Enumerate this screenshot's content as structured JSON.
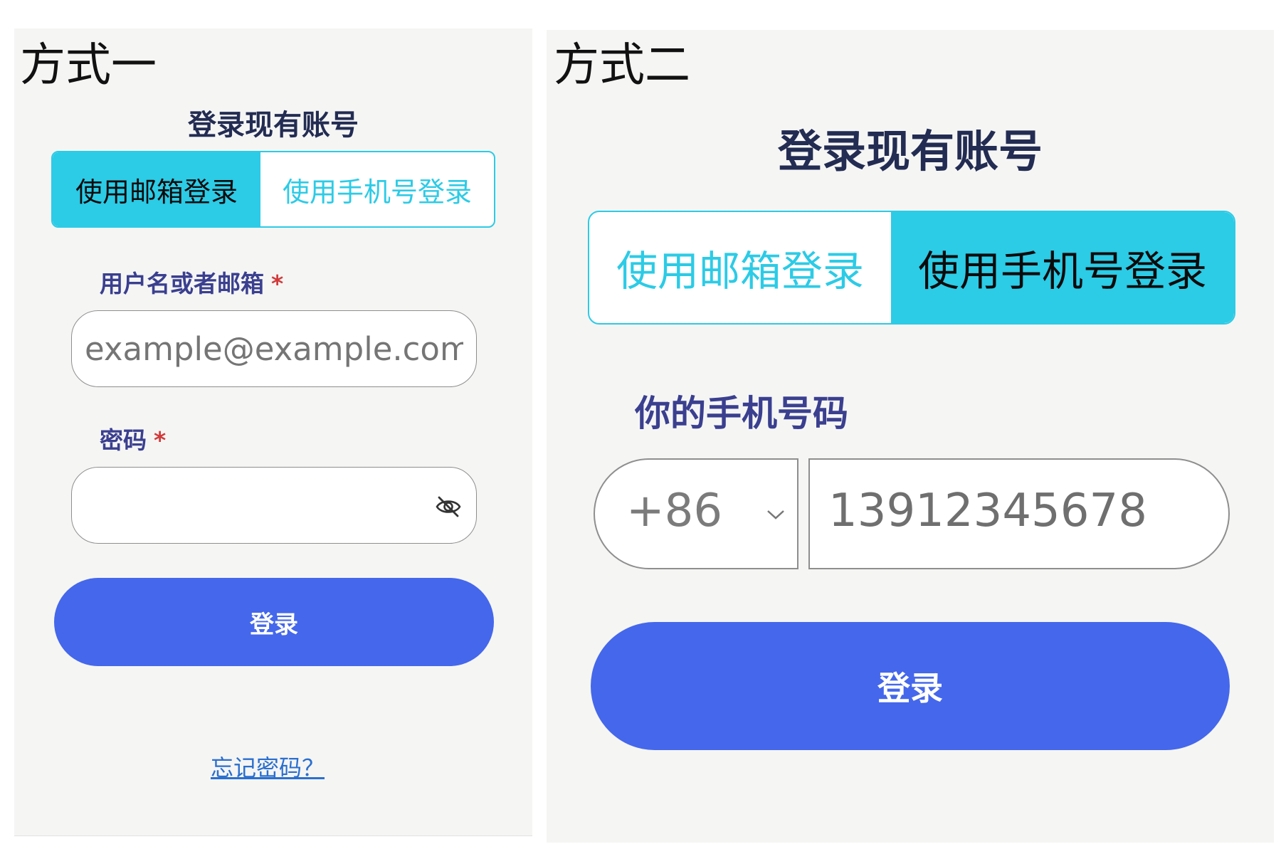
{
  "method_one": {
    "label": "方式一",
    "heading": "登录现有账号",
    "tabs": [
      {
        "label": "使用邮箱登录",
        "active": true
      },
      {
        "label": "使用手机号登录",
        "active": false
      }
    ],
    "username_label": "用户名或者邮箱",
    "required_mark": "*",
    "username_placeholder": "example@example.com",
    "password_label": "密码",
    "password_icon": "eye-off-icon",
    "login_button": "登录",
    "forgot_link": "忘记密码？"
  },
  "method_two": {
    "label": "方式二",
    "heading": "登录现有账号",
    "tabs": [
      {
        "label": "使用邮箱登录",
        "active": false
      },
      {
        "label": "使用手机号登录",
        "active": true
      }
    ],
    "phone_label": "你的手机号码",
    "country_code": "+86",
    "dropdown_icon": "chevron-down-icon",
    "phone_value": "13912345678",
    "login_button": "登录"
  },
  "colors": {
    "accent": "#2ccbe6",
    "primary": "#4467eb",
    "heading": "#232c52",
    "label": "#3a3f8f",
    "required": "#d23a3a",
    "link": "#2a6fcf",
    "panel_bg": "#f5f5f4"
  }
}
